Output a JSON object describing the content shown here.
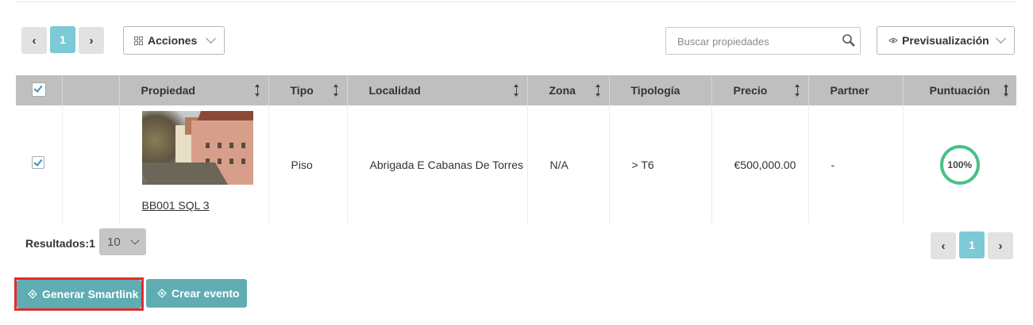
{
  "top_pager": {
    "prev": "‹",
    "page": "1",
    "next": "›"
  },
  "actions_label": "Acciones",
  "search": {
    "placeholder": "Buscar propiedades"
  },
  "preview_label": "Previsualización",
  "table": {
    "headers": {
      "propiedad": "Propiedad",
      "tipo": "Tipo",
      "localidad": "Localidad",
      "zona": "Zona",
      "tipologia": "Tipología",
      "precio": "Precio",
      "partner": "Partner",
      "puntuacion": "Puntuación"
    },
    "rows": [
      {
        "checked": true,
        "ref": "BB001 SQL 3",
        "tipo": "Piso",
        "localidad": "Abrigada E Cabanas De Torres",
        "zona": "N/A",
        "tipologia": "> T6",
        "precio": "€500,000.00",
        "partner": "-",
        "puntuacion": "100%",
        "score_value": 100
      }
    ]
  },
  "footer": {
    "results_label": "Resultados:1",
    "page_size": "10",
    "pager": {
      "prev": "‹",
      "page": "1",
      "next": "›"
    }
  },
  "buttons": {
    "smartlink": "Generar Smartlink",
    "event": "Crear evento"
  },
  "colors": {
    "accent": "#7bcad6",
    "action": "#5fadb3",
    "score": "#48c088",
    "highlight": "#e22b2b"
  }
}
